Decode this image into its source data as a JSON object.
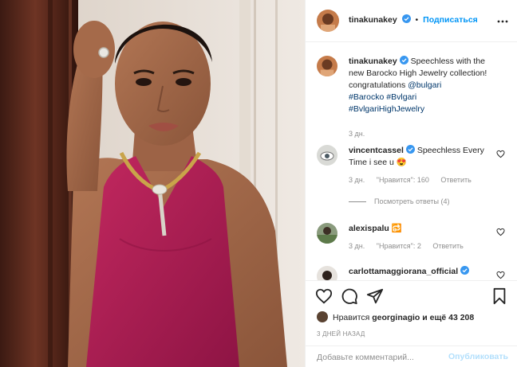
{
  "header": {
    "username": "tinakunakey",
    "separator": "•",
    "follow_label": "Подписаться",
    "more_icon": "more-horizontal-icon"
  },
  "caption": {
    "username": "tinakunakey",
    "text": "Speechless with the new Barocko High Jewelry collection! congratulations",
    "mention": "@bulgari",
    "hashtags": [
      "#Barocko",
      "#Bvlgari",
      "#BvlgariHighJewelry"
    ],
    "time": "3 дн."
  },
  "comments": [
    {
      "username": "vincentcassel",
      "verified": true,
      "text": "Speechless Every Time i see u 😍",
      "time": "3 дн.",
      "likes": "\"Нравится\": 160",
      "reply_label": "Ответить",
      "view_replies": "Посмотреть ответы (4)"
    },
    {
      "username": "alexispalu",
      "verified": false,
      "text": "🔂",
      "time": "3 дн.",
      "likes": "\"Нравится\": 2",
      "reply_label": "Ответить"
    },
    {
      "username": "carlottamaggiorana_official",
      "verified": true
    }
  ],
  "actions": {
    "icons": [
      "heart-icon",
      "comment-icon",
      "share-icon",
      "bookmark-icon"
    ],
    "likes_prefix": "Нравится",
    "likes_user": "georginagio",
    "likes_suffix": "и ещё 43 208",
    "time_ago": "3 ДНЕЙ НАЗАД"
  },
  "add_comment": {
    "placeholder": "Добавьте комментарий...",
    "publish_label": "Опубликовать"
  },
  "colors": {
    "accent_blue": "#0095f6",
    "link_blue": "#00376b",
    "muted_gray": "#8e8e8e",
    "dress_magenta": "#b01e55",
    "publish_disabled": "#b2dffc"
  }
}
